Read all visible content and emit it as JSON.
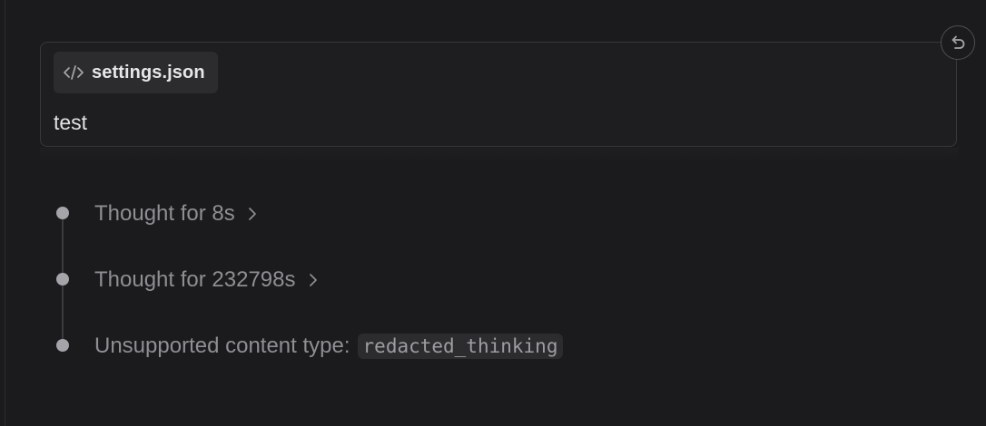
{
  "attachment": {
    "icon": "code-icon",
    "file_name": "settings.json"
  },
  "message": {
    "text": "test"
  },
  "actions": {
    "revert_icon": "undo-icon"
  },
  "timeline": {
    "items": [
      {
        "label": "Thought for 8s",
        "icon": "chevron-right-icon"
      },
      {
        "label": "Thought for 232798s",
        "icon": "chevron-right-icon"
      },
      {
        "label": "Unsupported content type:",
        "code": "redacted_thinking"
      }
    ]
  },
  "colors": {
    "background": "#1b1b1d",
    "card_border": "#38383b",
    "chip_background": "#2c2c2f",
    "primary_text": "#e7e7e9",
    "muted_text": "#8f8f93",
    "timeline_dot": "#a5a5a9"
  }
}
